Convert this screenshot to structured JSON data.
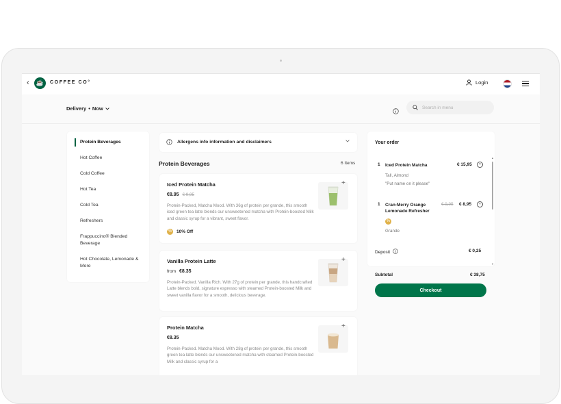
{
  "header": {
    "brand": "COFFEE CO°",
    "login_label": "Login",
    "logo_glyph": "☕",
    "back_glyph": "‹"
  },
  "subheader": {
    "delivery_label": "Delivery",
    "dot": "•",
    "time_label": "Now",
    "search_placeholder": "Search in menu"
  },
  "categories": {
    "items": [
      {
        "label": "Protein Beverages",
        "active": true
      },
      {
        "label": "Hot Coffee"
      },
      {
        "label": "Cold Coffee"
      },
      {
        "label": "Hot Tea"
      },
      {
        "label": "Cold Tea"
      },
      {
        "label": "Refreshers"
      },
      {
        "label": "Frappuccino® Blended Beverage"
      },
      {
        "label": "Hot Chocolate, Lemonade & More"
      }
    ]
  },
  "allergens": {
    "label": "Allergens info information and disclaimers"
  },
  "section": {
    "title": "Protein Beverages",
    "count": "6 Items"
  },
  "products": [
    {
      "name": "Iced Protein Matcha",
      "price": "€8.95",
      "old_price": "€ 9,95",
      "description": "Protein-Packed, Matcha Mood. With 36g of protein per grande, this smooth iced green tea latte blends our unsweetened matcha with Protein-boosted Milk and classic syrup for a vibrant, sweet flavor.",
      "promo": "10% Off"
    },
    {
      "name": "Vanilla Protein Latte",
      "from": "from",
      "price": "€8.35",
      "description": "Protein-Packed. Vanilla Rich. With 27g of protein per grande, this handcrafted Latte blends bold, signature espresso with steamed Protein-boosted Milk and sweet vanilla flavor for a smooth, delicious beverage."
    },
    {
      "name": "Protein Matcha",
      "price": "€8.35",
      "description": "Protein-Packed. Matcha Mood. With 28g of protein per grande, this smooth green tea latte blends our unsweetened matcha with steamed Protein-boosted Milk and classic syrup for a"
    }
  ],
  "order": {
    "title": "Your order",
    "items": [
      {
        "qty": "1",
        "name": "Iced Protein Matcha",
        "price": "€ 15,95",
        "notes": [
          "Tall, Almond",
          "\"Put name on it please\""
        ]
      },
      {
        "qty": "1",
        "name": "Cran-Merry Orange Lemonade Refresher",
        "old_price": "€ 9,95",
        "price": "€ 8,95",
        "size": "Grande"
      }
    ],
    "deposit_label": "Deposit",
    "deposit_value": "€ 0,25",
    "subtotal_label": "Subtotal",
    "subtotal_value": "€ 38,75",
    "checkout_label": "Checkout"
  },
  "colors": {
    "brand_green": "#006241",
    "button_green": "#00754a",
    "promo_gold": "#e0b24a"
  },
  "icons": [
    "back-icon",
    "logo-icon",
    "user-icon",
    "flag-icon",
    "menu-icon",
    "info-icon",
    "search-icon",
    "chevron-down-icon",
    "plus-icon",
    "remove-icon",
    "promo-icon"
  ]
}
